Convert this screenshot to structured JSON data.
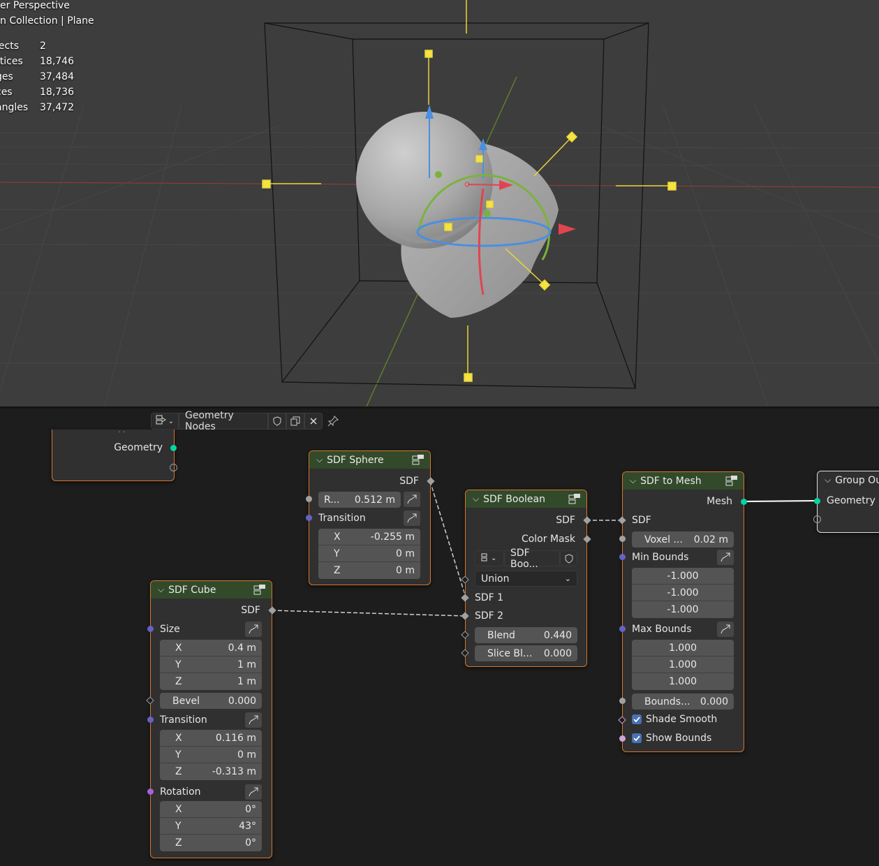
{
  "viewport": {
    "title": "er Perspective",
    "subtitle": "n Collection | Plane",
    "stats": [
      {
        "label": "jects",
        "value": "2"
      },
      {
        "label": "rtices",
        "value": "18,746"
      },
      {
        "label": "ges",
        "value": "37,484"
      },
      {
        "label": "ces",
        "value": "18,736"
      },
      {
        "label": "angles",
        "value": "37,472"
      }
    ]
  },
  "editor": {
    "tree_name": "Geometry Nodes"
  },
  "group_input": {
    "partial_label": ". .",
    "output_geometry": "Geometry"
  },
  "sdf_sphere": {
    "title": "SDF Sphere",
    "out_sdf": "SDF",
    "radius_label": "R...",
    "radius_value": "0.512 m",
    "transition_label": "Transition",
    "x_label": "X",
    "x_value": "-0.255 m",
    "y_label": "Y",
    "y_value": "0 m",
    "z_label": "Z",
    "z_value": "0 m"
  },
  "sdf_cube": {
    "title": "SDF Cube",
    "out_sdf": "SDF",
    "size_label": "Size",
    "size_x_label": "X",
    "size_x": "0.4 m",
    "size_y_label": "Y",
    "size_y": "1 m",
    "size_z_label": "Z",
    "size_z": "1 m",
    "bevel_label": "Bevel",
    "bevel_value": "0.000",
    "transition_label": "Transition",
    "t_x_label": "X",
    "t_x": "0.116 m",
    "t_y_label": "Y",
    "t_y": "0 m",
    "t_z_label": "Z",
    "t_z": "-0.313 m",
    "rotation_label": "Rotation",
    "r_x_label": "X",
    "r_x": "0°",
    "r_y_label": "Y",
    "r_y": "43°",
    "r_z_label": "Z",
    "r_z": "0°"
  },
  "sdf_boolean": {
    "title": "SDF Boolean",
    "out_sdf": "SDF",
    "out_color_mask": "Color Mask",
    "subgroup_name": "SDF Boo...",
    "operation": "Union",
    "in_sdf1": "SDF 1",
    "in_sdf2": "SDF 2",
    "blend_label": "Blend",
    "blend_value": "0.440",
    "slice_label": "Slice Bl...",
    "slice_value": "0.000"
  },
  "sdf_to_mesh": {
    "title": "SDF to Mesh",
    "out_mesh": "Mesh",
    "in_sdf": "SDF",
    "voxel_label": "Voxel ...",
    "voxel_value": "0.02 m",
    "min_bounds_label": "Min Bounds",
    "min_x": "-1.000",
    "min_y": "-1.000",
    "min_z": "-1.000",
    "max_bounds_label": "Max Bounds",
    "max_x": "1.000",
    "max_y": "1.000",
    "max_z": "1.000",
    "bounds_label": "Bounds...",
    "bounds_value": "0.000",
    "shade_smooth": "Shade Smooth",
    "show_bounds": "Show Bounds"
  },
  "group_output": {
    "title": "Group Ou",
    "in_geometry": "Geometry"
  },
  "colors": {
    "viewport_bg": "#3d3d3d",
    "editor_bg": "#1d1d1d",
    "node_header": "#324a2a",
    "node_border_selected": "#d8762e",
    "socket_geometry": "#00d6a3",
    "socket_vector": "#6363c7",
    "socket_float": "#a1a1a1",
    "socket_rotation": "#a363d6",
    "socket_bool": "#cca6d6"
  }
}
